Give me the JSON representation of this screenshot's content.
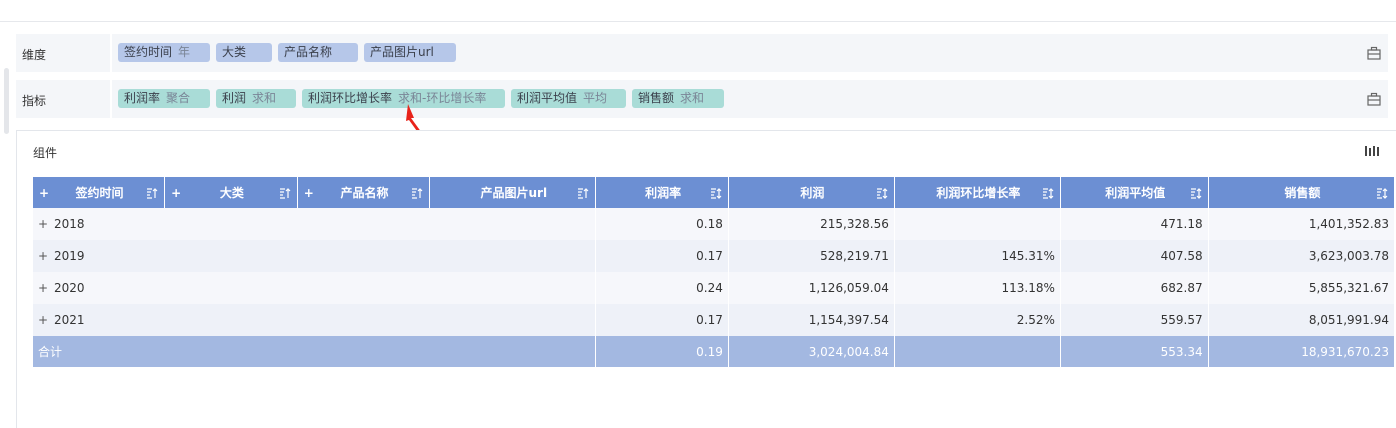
{
  "shelves": {
    "dimension": {
      "label": "维度",
      "pills": [
        {
          "name": "签约时间",
          "agg": "年"
        },
        {
          "name": "大类",
          "agg": ""
        },
        {
          "name": "产品名称",
          "agg": ""
        },
        {
          "name": "产品图片url",
          "agg": ""
        }
      ]
    },
    "indicator": {
      "label": "指标",
      "pills": [
        {
          "name": "利润率",
          "agg": "聚合"
        },
        {
          "name": "利润",
          "agg": "求和"
        },
        {
          "name": "利润环比增长率",
          "agg": "求和-环比增长率"
        },
        {
          "name": "利润平均值",
          "agg": "平均"
        },
        {
          "name": "销售额",
          "agg": "求和"
        }
      ]
    }
  },
  "panel": {
    "title": "组件"
  },
  "table": {
    "columns": [
      {
        "label": "签约时间",
        "plus": "+"
      },
      {
        "label": "大类",
        "plus": "+"
      },
      {
        "label": "产品名称",
        "plus": "+"
      },
      {
        "label": "产品图片url",
        "plus": ""
      },
      {
        "label": "利润率",
        "plus": ""
      },
      {
        "label": "利润",
        "plus": ""
      },
      {
        "label": "利润环比增长率",
        "plus": ""
      },
      {
        "label": "利润平均值",
        "plus": ""
      },
      {
        "label": "销售额",
        "plus": ""
      }
    ],
    "rows": [
      {
        "expand": "+",
        "year": "2018",
        "rate": "0.18",
        "profit": "215,328.56",
        "mom": "",
        "avg": "471.18",
        "sales": "1,401,352.83"
      },
      {
        "expand": "+",
        "year": "2019",
        "rate": "0.17",
        "profit": "528,219.71",
        "mom": "145.31%",
        "avg": "407.58",
        "sales": "3,623,003.78"
      },
      {
        "expand": "+",
        "year": "2020",
        "rate": "0.24",
        "profit": "1,126,059.04",
        "mom": "113.18%",
        "avg": "682.87",
        "sales": "5,855,321.67"
      },
      {
        "expand": "+",
        "year": "2021",
        "rate": "0.17",
        "profit": "1,154,397.54",
        "mom": "2.52%",
        "avg": "559.57",
        "sales": "8,051,991.94"
      }
    ],
    "total": {
      "label": "合计",
      "rate": "0.19",
      "profit": "3,024,004.84",
      "mom": "",
      "avg": "553.34",
      "sales": "18,931,670.23"
    }
  },
  "colors": {
    "header": "#6c8fd3",
    "total_row": "#a3b8e1",
    "dimension_pill": "#b6c7e9",
    "indicator_pill": "#a9dcd7",
    "annotation_arrow": "#e8231a"
  },
  "icons": {
    "shelf_action": "toolbox-icon",
    "panel_action": "column-settings-icon",
    "sort": "sort-icon"
  }
}
